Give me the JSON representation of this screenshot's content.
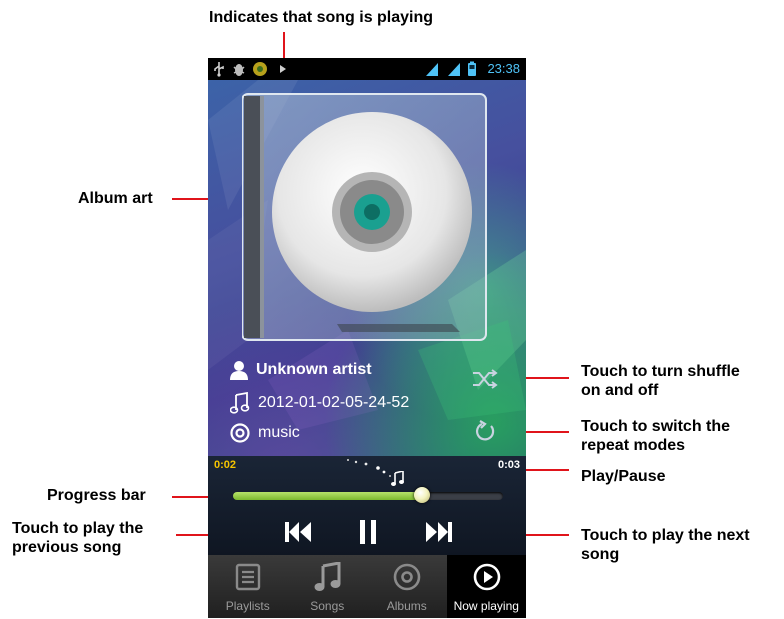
{
  "annotations": {
    "song_playing": "Indicates that song is playing",
    "album_art": "Album art",
    "shuffle_line1": "Touch to turn shuffle",
    "shuffle_line2": "on and off",
    "repeat_line1": "Touch to switch the",
    "repeat_line2": "repeat modes",
    "play_pause": "Play/Pause",
    "progress_bar": "Progress bar",
    "prev_line1": "Touch to play the",
    "prev_line2": "previous song",
    "next_line1": "Touch to play the next",
    "next_line2": "song"
  },
  "status_bar": {
    "time": "23:38",
    "icons": [
      "usb-icon",
      "debug-icon",
      "notification-icon",
      "playing-indicator-icon",
      "signal-icon",
      "signal-icon",
      "battery-icon"
    ]
  },
  "track": {
    "artist": "Unknown artist",
    "title": "2012-01-02-05-24-52",
    "album": "music"
  },
  "progress": {
    "elapsed": "0:02",
    "total": "0:03",
    "fraction": 0.7
  },
  "tabs": [
    {
      "label": "Playlists",
      "icon": "playlist-icon",
      "active": false
    },
    {
      "label": "Songs",
      "icon": "music-note-icon",
      "active": false
    },
    {
      "label": "Albums",
      "icon": "disc-icon",
      "active": false
    },
    {
      "label": "Now playing",
      "icon": "play-circle-icon",
      "active": true
    }
  ],
  "colors": {
    "annotation_line": "#e0141b",
    "progress_fill": "#8bc53f",
    "time_elapsed": "#f5c400",
    "status_time": "#4fc3f7"
  }
}
